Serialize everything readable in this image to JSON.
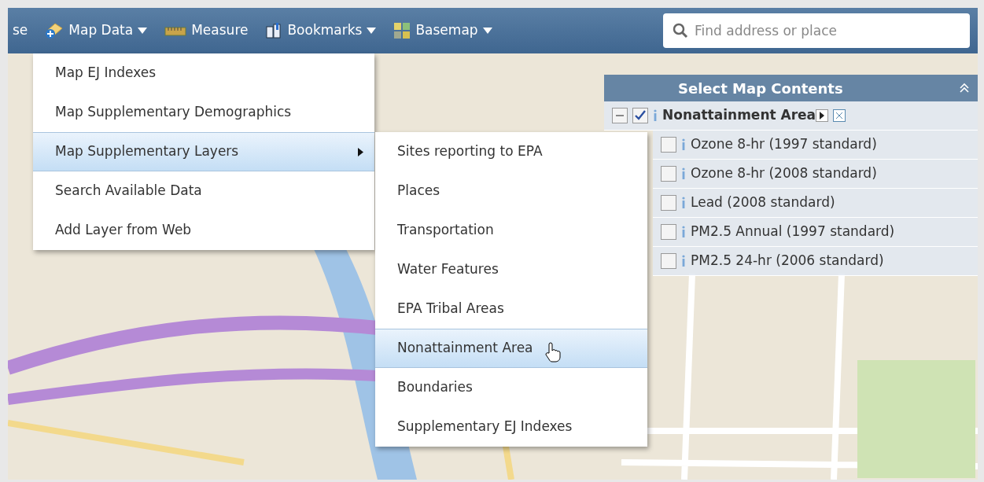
{
  "toolbar": {
    "items": [
      {
        "kind": "cut",
        "label": "se"
      },
      {
        "kind": "dropdown",
        "label": "Map Data"
      },
      {
        "kind": "button",
        "label": "Measure"
      },
      {
        "kind": "dropdown",
        "label": "Bookmarks"
      },
      {
        "kind": "dropdown",
        "label": "Basemap"
      }
    ],
    "search": {
      "placeholder": "Find address or place"
    }
  },
  "menu": {
    "items": [
      {
        "label": "Map EJ Indexes",
        "selected": false,
        "submenu": false
      },
      {
        "label": "Map Supplementary Demographics",
        "selected": false,
        "submenu": false
      },
      {
        "label": "Map Supplementary Layers",
        "selected": true,
        "submenu": true
      },
      {
        "label": "Search Available Data",
        "selected": false,
        "submenu": false
      },
      {
        "label": "Add Layer from Web",
        "selected": false,
        "submenu": false
      }
    ]
  },
  "submenu": {
    "items": [
      {
        "label": "Sites reporting to EPA",
        "selected": false
      },
      {
        "label": "Places",
        "selected": false
      },
      {
        "label": "Transportation",
        "selected": false
      },
      {
        "label": "Water Features",
        "selected": false
      },
      {
        "label": "EPA Tribal Areas",
        "selected": false
      },
      {
        "label": "Nonattainment Area",
        "selected": true
      },
      {
        "label": "Boundaries",
        "selected": false
      },
      {
        "label": "Supplementary EJ Indexes",
        "selected": false
      }
    ]
  },
  "layers_panel": {
    "title": "Select Map Contents",
    "group": {
      "label": "Nonattainment Area",
      "checked": true,
      "expanded": true,
      "children": [
        {
          "label": "Ozone 8-hr (1997 standard)",
          "checked": false
        },
        {
          "label": "Ozone 8-hr (2008 standard)",
          "checked": false
        },
        {
          "label": "Lead (2008 standard)",
          "checked": false
        },
        {
          "label": "PM2.5 Annual (1997 standard)",
          "checked": false
        },
        {
          "label": "PM2.5 24-hr (2006 standard)",
          "checked": false
        }
      ]
    }
  }
}
